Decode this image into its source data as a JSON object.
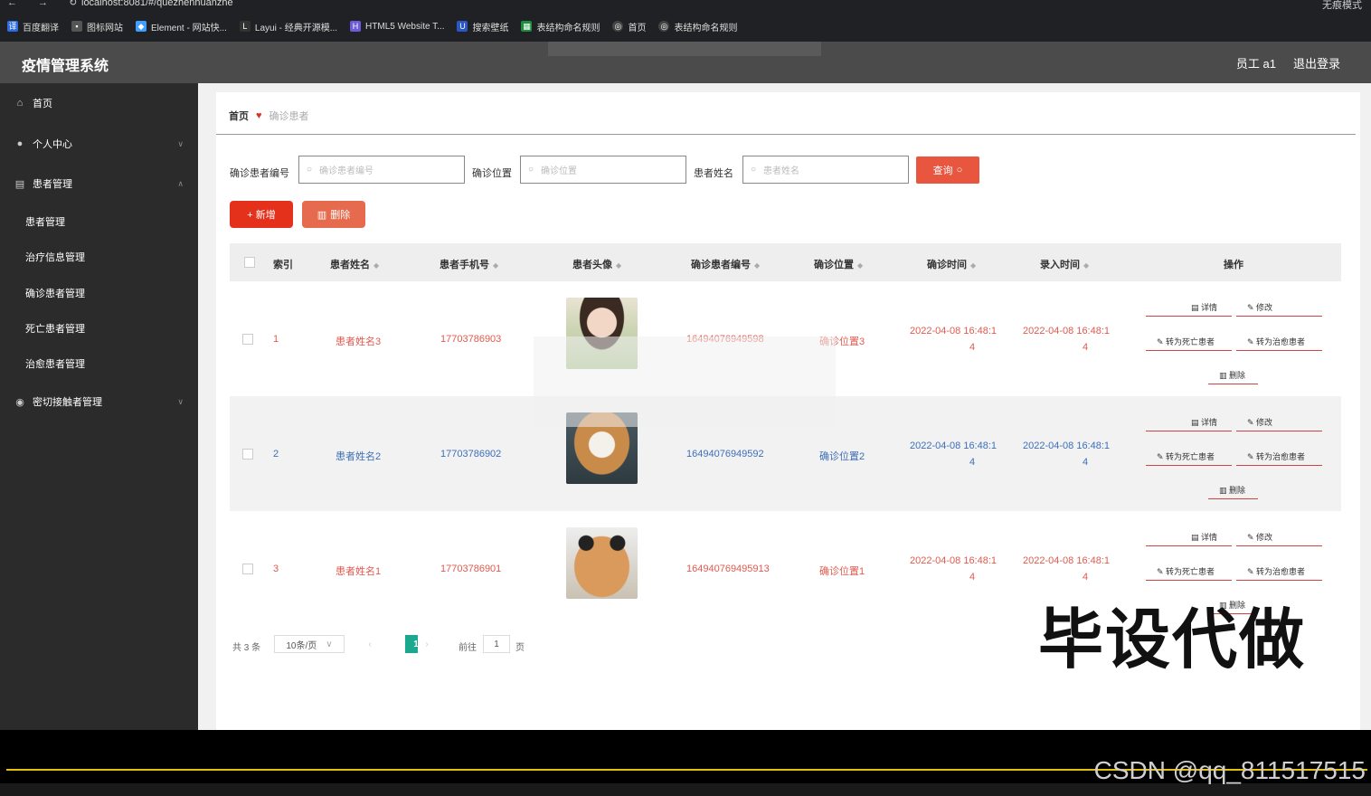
{
  "browser": {
    "url": "localhost:8081/#/quezhenhuanzhe",
    "profile": "无痕模式",
    "bookmarks": [
      "百度翻译",
      "图标网站",
      "Element - 网站快...",
      "Layui - 经典开源模...",
      "HTML5 Website T...",
      "搜索壁纸",
      "表结构命名规则",
      "首页",
      "表结构命名规则"
    ]
  },
  "header": {
    "title": "疫情管理系统",
    "user": "员工 a1",
    "logout": "退出登录"
  },
  "sidebar": {
    "items": [
      {
        "label": "首页",
        "icon": "home-icon"
      },
      {
        "label": "个人中心",
        "icon": "user-icon"
      },
      {
        "label": "患者管理",
        "icon": "list-icon"
      },
      {
        "label": "密切接触者管理",
        "icon": "location-icon"
      }
    ],
    "subitems": [
      "患者管理",
      "治疗信息管理",
      "确诊患者管理",
      "死亡患者管理",
      "治愈患者管理"
    ]
  },
  "breadcrumb": {
    "home": "首页",
    "current": "确诊患者"
  },
  "search": {
    "fields": [
      {
        "label": "确诊患者编号",
        "placeholder": "确诊患者编号"
      },
      {
        "label": "确诊位置",
        "placeholder": "确诊位置"
      },
      {
        "label": "患者姓名",
        "placeholder": "患者姓名"
      }
    ],
    "query": "查询"
  },
  "actions": {
    "add": "+ 新增",
    "delete": "删除"
  },
  "table": {
    "headers": [
      "索引",
      "患者姓名",
      "患者手机号",
      "患者头像",
      "确诊患者编号",
      "确诊位置",
      "确诊时间",
      "录入时间",
      "操作"
    ],
    "rows": [
      {
        "index": "1",
        "name": "患者姓名3",
        "phone": "17703786903",
        "code": "16494076949598",
        "location": "确诊位置3",
        "diag_time_1": "2022-04-08 16:48:1",
        "diag_time_2": "4",
        "entry_time_1": "2022-04-08 16:48:1",
        "entry_time_2": "4",
        "color": "#e05a4e"
      },
      {
        "index": "2",
        "name": "患者姓名2",
        "phone": "17703786902",
        "code": "16494076949592",
        "location": "确诊位置2",
        "diag_time_1": "2022-04-08 16:48:1",
        "diag_time_2": "4",
        "entry_time_1": "2022-04-08 16:48:1",
        "entry_time_2": "4",
        "color": "#3d6fb8"
      },
      {
        "index": "3",
        "name": "患者姓名1",
        "phone": "17703786901",
        "code": "164940769495913",
        "location": "确诊位置1",
        "diag_time_1": "2022-04-08 16:48:1",
        "diag_time_2": "4",
        "entry_time_1": "2022-04-08 16:48:1",
        "entry_time_2": "4",
        "color": "#e05a4e"
      }
    ],
    "ops": {
      "detail": "详情",
      "edit": "修改",
      "to_dead": "转为死亡患者",
      "to_cured": "转为治愈患者",
      "delete": "删除"
    }
  },
  "pagination": {
    "total": "共 3 条",
    "page_size": "10条/页",
    "current_page": "1",
    "goto_label": "前往",
    "goto_value": "1",
    "page_unit": "页"
  },
  "overlay": {
    "watermark": "毕设代做",
    "csdn": "CSDN @qq_811517515"
  }
}
